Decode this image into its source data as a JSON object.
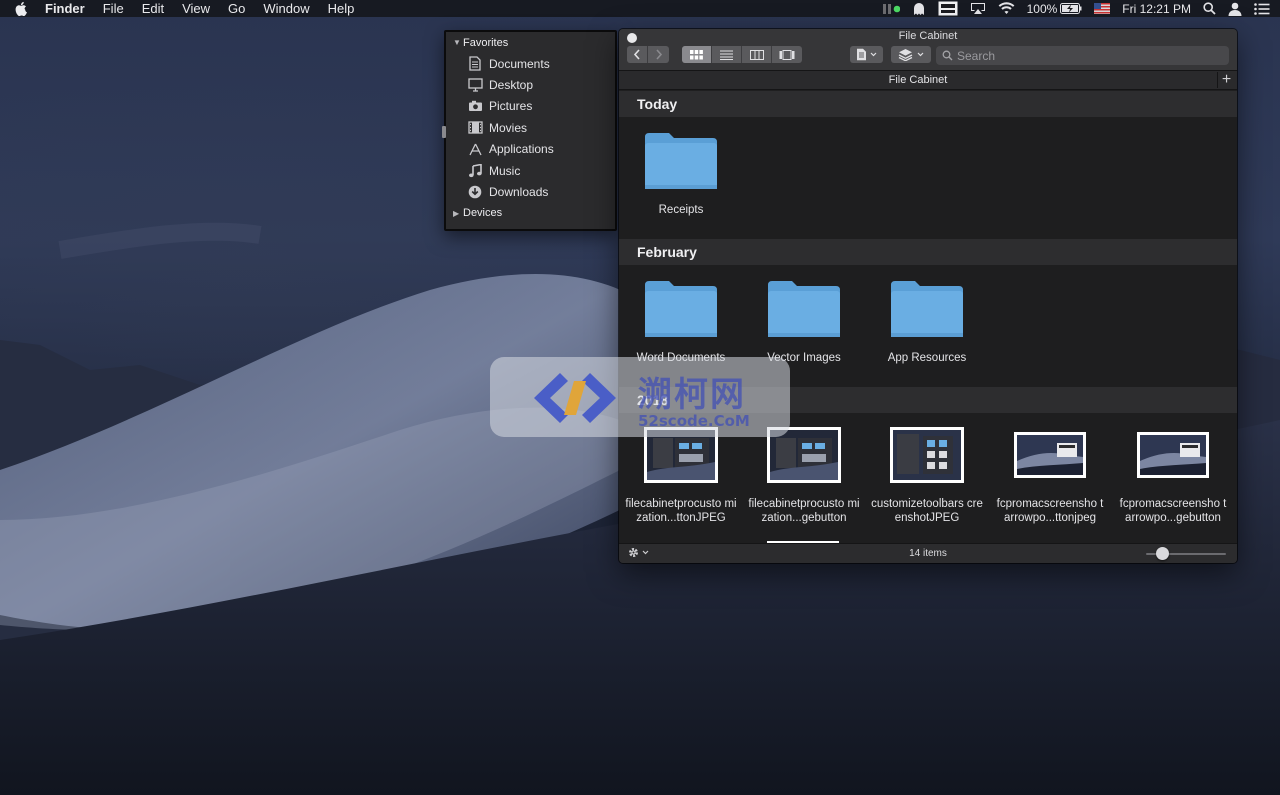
{
  "menubar": {
    "app_name": "Finder",
    "menus": [
      "File",
      "Edit",
      "View",
      "Go",
      "Window",
      "Help"
    ],
    "battery": "100%",
    "clock": "Fri 12:21 PM"
  },
  "sidebar": {
    "favorites_label": "Favorites",
    "items": [
      {
        "label": "Documents",
        "icon": "document-icon"
      },
      {
        "label": "Desktop",
        "icon": "desktop-icon"
      },
      {
        "label": "Pictures",
        "icon": "camera-icon"
      },
      {
        "label": "Movies",
        "icon": "film-icon"
      },
      {
        "label": "Applications",
        "icon": "applications-icon"
      },
      {
        "label": "Music",
        "icon": "music-icon"
      },
      {
        "label": "Downloads",
        "icon": "downloads-icon"
      }
    ],
    "devices_label": "Devices"
  },
  "window": {
    "title": "File Cabinet",
    "tab_label": "File Cabinet",
    "search_placeholder": "Search",
    "status_count": "14 items",
    "icon_size_fraction": 0.15,
    "sections": [
      {
        "title": "Today",
        "items": [
          {
            "name": "Receipts",
            "kind": "folder"
          }
        ]
      },
      {
        "title": "February",
        "items": [
          {
            "name": "Word Documents",
            "kind": "folder"
          },
          {
            "name": "Vector Images",
            "kind": "folder"
          },
          {
            "name": "App Resources",
            "kind": "folder"
          }
        ]
      },
      {
        "title": "2018",
        "items": [
          {
            "name": "filecabinetprocusto mization...ttonJPEG",
            "kind": "screenshot"
          },
          {
            "name": "filecabinetprocusto mization...gebutton",
            "kind": "screenshot"
          },
          {
            "name": "customizetoolbars creenshotJPEG",
            "kind": "screenshot"
          },
          {
            "name": "fcpromacscreensho tarrowpo...ttonjpeg",
            "kind": "screenshot"
          },
          {
            "name": "fcpromacscreensho tarrowpo...gebutton",
            "kind": "screenshot"
          }
        ]
      }
    ]
  },
  "watermark": {
    "chinese": "溯柯网",
    "site": "52scode.CoM"
  },
  "colors": {
    "folder_blue": "#6aaee3",
    "folder_tab": "#5a9fd6",
    "window_bg": "#1f1f20",
    "section_header": "#2d2d2f"
  }
}
